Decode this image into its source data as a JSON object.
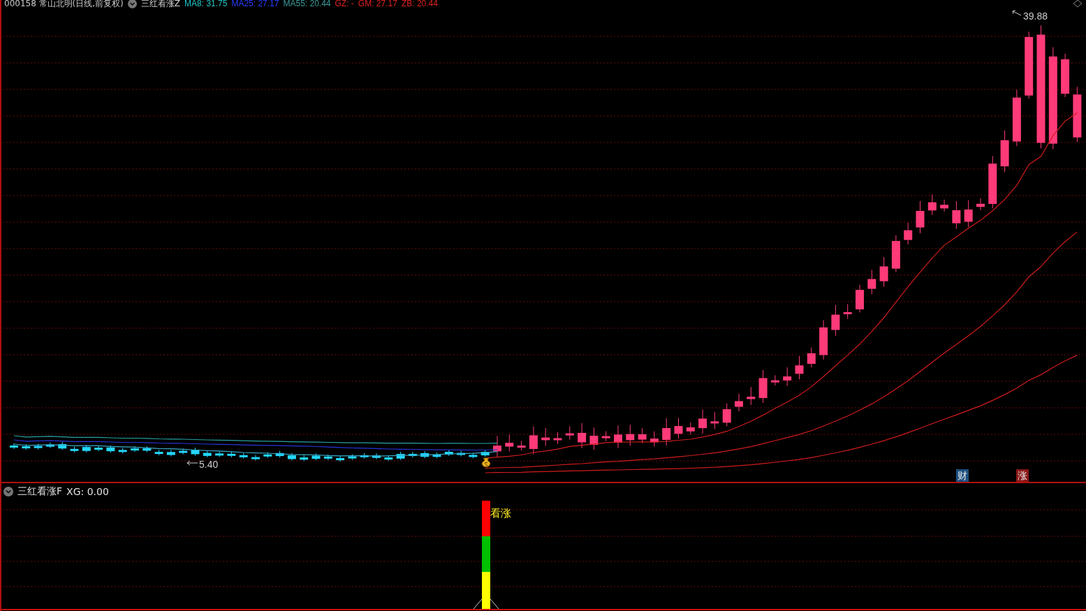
{
  "header": {
    "title": "000158 常山北明(日线,前复权)",
    "indicator": "三红看涨Z",
    "values": [
      {
        "text": "MA8: 31.75",
        "color": "#22c4c4"
      },
      {
        "text": "MA25: 27.17",
        "color": "#2a3cff"
      },
      {
        "text": "MA55: 20.44",
        "color": "#3a9a9a"
      },
      {
        "text": "GZ: -",
        "color": "#e02222"
      },
      {
        "text": "GM: 27.17",
        "color": "#e02222"
      },
      {
        "text": "ZB: 20.44",
        "color": "#e02222"
      }
    ]
  },
  "main_chart": {
    "high_label": "39.88",
    "low_label": "5.40",
    "badges": [
      {
        "text": "财",
        "color": "#1d4f80"
      },
      {
        "text": "涨",
        "color": "#8a1616"
      }
    ]
  },
  "sub_panel": {
    "indicator": "三红看涨F",
    "reading": "XG: 0.00",
    "signal_label": "看涨"
  }
}
